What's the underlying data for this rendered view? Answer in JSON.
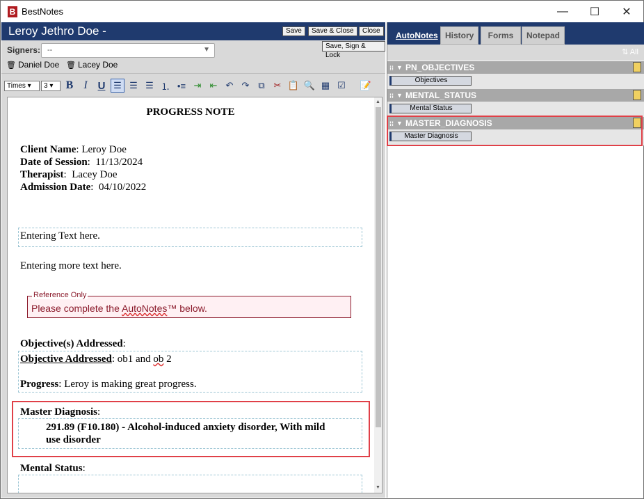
{
  "window": {
    "title": "BestNotes",
    "logo_letter": "B",
    "minimize": "—",
    "maximize": "☐",
    "close": "✕"
  },
  "header": {
    "patient_name": "Leroy Jethro Doe -",
    "save_label": "Save",
    "save_close_label": "Save & Close",
    "close_label": "Close",
    "save_sign_lock_label": "Save, Sign & Lock"
  },
  "signers": {
    "label": "Signers:",
    "placeholder": "--",
    "list": [
      "Daniel Doe",
      "Lacey Doe"
    ]
  },
  "toolbar": {
    "font": "Times",
    "size": "3",
    "buttons": [
      "bold-icon",
      "italic-icon",
      "underline-icon",
      "align-left-icon",
      "align-center-icon",
      "align-right-icon",
      "numbered-list-icon",
      "bullet-list-icon",
      "indent-icon",
      "outdent-icon",
      "undo-icon",
      "redo-icon",
      "copy-icon",
      "cut-icon",
      "paste-icon",
      "spellcheck-icon",
      "table-icon",
      "checkbox-icon",
      "note-icon"
    ],
    "active_align": "left"
  },
  "document": {
    "title": "PROGRESS NOTE",
    "fields": [
      {
        "label": "Client Name",
        "value": "Leroy Doe"
      },
      {
        "label": "Date of Session",
        "value": "11/13/2024"
      },
      {
        "label": "Therapist",
        "value": "Lacey Doe"
      },
      {
        "label": "Admission Date",
        "value": "04/10/2022"
      }
    ],
    "text1": "Entering Text here.",
    "text2": "Entering more text here.",
    "reference": {
      "legend": "Reference Only",
      "text_prefix": "Please complete the ",
      "text_link": "AutoNotes",
      "text_suffix": "™ below."
    },
    "objectives_heading": "Objective(s) Addressed",
    "objective_label": "Objective Addressed",
    "objective_value_1": "ob1 and ",
    "objective_value_2": "ob",
    "objective_value_3": " 2",
    "progress_label": "Progress",
    "progress_value": "Leroy is making great progress.",
    "master_diagnosis_heading": "Master Diagnosis",
    "master_diagnosis_line1": "291.89 (F10.180) - Alcohol-induced anxiety disorder, With mild",
    "master_diagnosis_line2": "use disorder",
    "mental_status_heading": "Mental Status"
  },
  "right_panel": {
    "tabs": [
      "AutoNotes",
      "History",
      "Forms",
      "Notepad"
    ],
    "active_tab": "AutoNotes",
    "all_label": "All",
    "sections": [
      {
        "name": "PN_OBJECTIVES",
        "item": "Objectives"
      },
      {
        "name": "MENTAL_STATUS",
        "item": "Mental Status"
      },
      {
        "name": "MASTER_DIAGNOSIS",
        "item": "Master Diagnosis"
      }
    ]
  },
  "colors": {
    "header_navy": "#1f3a6e",
    "highlight_red": "#e04048",
    "reference_red": "#8b1a2b"
  }
}
